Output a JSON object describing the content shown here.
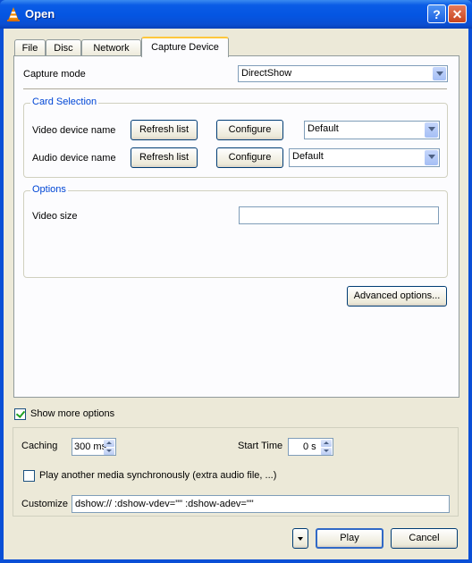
{
  "window": {
    "title": "Open",
    "icons": [
      "vlc-cone-icon",
      "help-icon",
      "close-icon"
    ],
    "help_label": "?",
    "close_label": "✕"
  },
  "tabs": [
    {
      "label": "File"
    },
    {
      "label": "Disc"
    },
    {
      "label": "Network"
    },
    {
      "label": "Capture Device",
      "active": true
    }
  ],
  "capture": {
    "mode_label": "Capture mode",
    "mode_value": "DirectShow",
    "card_selection": {
      "title": "Card Selection",
      "video_label": "Video device name",
      "audio_label": "Audio device name",
      "refresh_label": "Refresh list",
      "configure_label": "Configure",
      "video_value": "Default",
      "audio_value": "Default"
    },
    "options": {
      "title": "Options",
      "video_size_label": "Video size",
      "video_size_value": ""
    },
    "advanced_label": "Advanced options..."
  },
  "more": {
    "show_more_label": "Show more options",
    "show_more_checked": true,
    "caching_label": "Caching",
    "caching_value": "300 ms",
    "start_time_label": "Start Time",
    "start_time_value": "0 s",
    "play_another_label": "Play another media synchronously (extra audio file, ...)",
    "play_another_checked": false,
    "customize_label": "Customize",
    "customize_value": "dshow:// :dshow-vdev=\"\" :dshow-adev=\"\""
  },
  "footer": {
    "dropdown_icon": "chevron-down-icon",
    "play_label": "Play",
    "cancel_label": "Cancel"
  },
  "colors": {
    "title_bar": "#0a5ce6",
    "dialog_bg": "#ece9d8",
    "group_title": "#0046d5",
    "tab_highlight": "#ffc73c"
  }
}
